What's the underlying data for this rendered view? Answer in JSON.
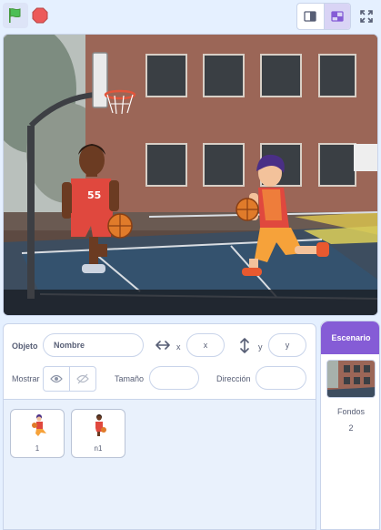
{
  "toolbar": {
    "green_flag_icon": "green-flag-icon",
    "stop_icon": "stop-sign-icon",
    "small_stage_icon": "small-stage-layout-icon",
    "normal_stage_icon": "normal-stage-layout-icon",
    "fullscreen_icon": "fullscreen-icon",
    "accent": "#855cd6",
    "flag_color": "#4cbf56",
    "stop_color": "#ec5959"
  },
  "sprite_info": {
    "sprite_label": "Objeto",
    "sprite_name_placeholder": "Nombre",
    "x_label": "x",
    "x_placeholder": "x",
    "y_label": "y",
    "y_placeholder": "y",
    "show_label": "Mostrar",
    "size_label": "Tamaño",
    "direction_label": "Dirección"
  },
  "sprites": [
    {
      "name": "1"
    },
    {
      "name": "n1"
    }
  ],
  "stage_panel": {
    "tab_label": "Escenario",
    "backdrops_label": "Fondos",
    "backdrops_count": "2"
  }
}
